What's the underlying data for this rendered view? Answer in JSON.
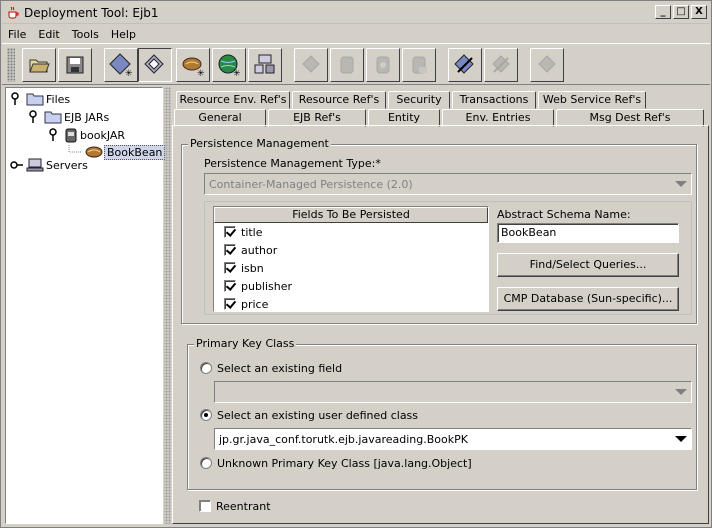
{
  "window": {
    "title": "Deployment Tool: Ejb1",
    "minimize": "_",
    "maximize": "□",
    "close": "X"
  },
  "menu": [
    {
      "label": "File"
    },
    {
      "label": "Edit"
    },
    {
      "label": "Tools"
    },
    {
      "label": "Help"
    }
  ],
  "toolbar": {
    "buttons": [
      "open-icon",
      "save-icon",
      "new-application-icon",
      "new-ejb-icon",
      "new-bean-icon",
      "new-web-icon",
      "new-client-icon",
      "deploy-disabled-icon",
      "jar-disabled-icon",
      "verify-disabled-icon",
      "server-disabled-icon",
      "update-icon",
      "undeploy-disabled-icon",
      "remove-disabled-icon"
    ]
  },
  "tree": {
    "files": "Files",
    "ejb_jars": "EJB JARs",
    "book_jar": "bookJAR",
    "book_bean": "BookBean",
    "servers": "Servers"
  },
  "tabs": {
    "row1": [
      "Resource Env. Ref's",
      "Resource Ref's",
      "Security",
      "Transactions",
      "Web Service Ref's"
    ],
    "row2": [
      "General",
      "EJB Ref's",
      "Entity",
      "Env. Entries",
      "Msg Dest Ref's"
    ],
    "active": "Entity"
  },
  "persistence": {
    "group_title": "Persistence Management",
    "type_label": "Persistence Management Type:*",
    "type_value": "Container-Managed Persistence (2.0)",
    "fields_header": "Fields To Be Persisted",
    "fields": [
      {
        "name": "title",
        "checked": true
      },
      {
        "name": "author",
        "checked": true
      },
      {
        "name": "isbn",
        "checked": true
      },
      {
        "name": "publisher",
        "checked": true
      },
      {
        "name": "price",
        "checked": true
      }
    ],
    "schema_label": "Abstract Schema Name:",
    "schema_value": "BookBean",
    "find_button": "Find/Select Queries...",
    "cmp_button": "CMP Database (Sun-specific)..."
  },
  "primary_key": {
    "group_title": "Primary Key Class",
    "option_existing_field": "Select an existing field",
    "existing_field_value": "",
    "option_user_class": "Select an existing user defined class",
    "user_class_value": "jp.gr.java_conf.torutk.ejb.javareading.BookPK",
    "option_unknown": "Unknown Primary Key Class [java.lang.Object]",
    "selected": "user_class"
  },
  "reentrant": {
    "label": "Reentrant",
    "checked": false
  }
}
